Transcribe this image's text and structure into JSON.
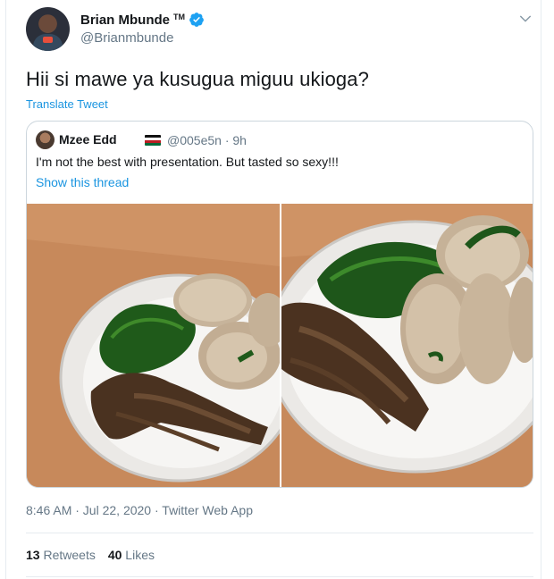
{
  "author": {
    "name": "Brian Mbunde",
    "tm": "TM",
    "handle": "@Brianmbunde"
  },
  "tweet": {
    "text": "Hii si mawe ya kusugua miguu ukioga?",
    "translate_label": "Translate Tweet",
    "timestamp": "8:46 AM · Jul 22, 2020",
    "separator": " · ",
    "source": "Twitter Web App",
    "retweets_count": "13",
    "retweets_label": "Retweets",
    "likes_count": "40",
    "likes_label": "Likes"
  },
  "quoted": {
    "name": "Mzee Edd",
    "handle_time": "@005e5n · 9h",
    "text": "I'm not the best with presentation. But tasted so sexy!!!",
    "thread_link": "Show this thread"
  },
  "colors": {
    "link": "#1b95e0",
    "verified": "#1da1f2",
    "muted": "#657786"
  },
  "icons": [
    "verified-badge-icon",
    "chevron-down-icon",
    "kenya-flag-icon"
  ]
}
